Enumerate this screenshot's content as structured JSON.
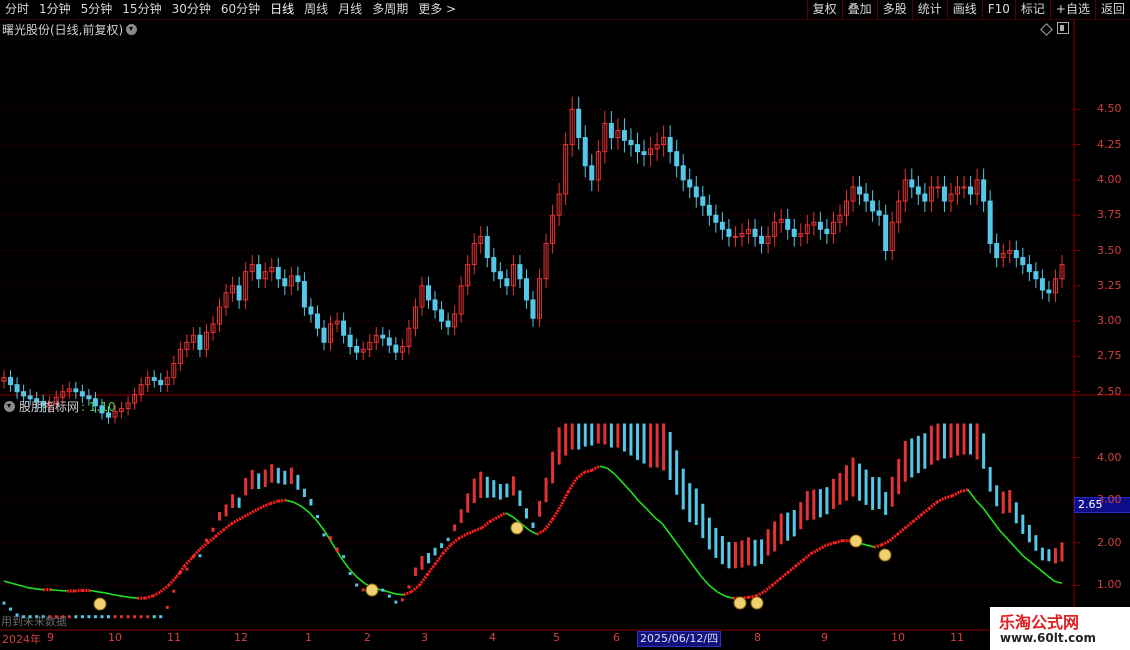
{
  "toolbar": {
    "periods": [
      "分时",
      "1分钟",
      "5分钟",
      "15分钟",
      "30分钟",
      "60分钟",
      "日线",
      "周线",
      "月线",
      "多周期",
      "更多 >"
    ],
    "active_period": "日线",
    "actions": [
      "复权",
      "叠加",
      "多股",
      "统计",
      "画线",
      "F10",
      "标记",
      "+自选",
      "返回"
    ]
  },
  "main_panel": {
    "title": "曙光股份(日线,前复权)",
    "yticks": [
      "4.50",
      "4.25",
      "4.00",
      "3.75",
      "3.50",
      "3.25",
      "3.00",
      "2.75",
      "2.50"
    ]
  },
  "indicator_panel": {
    "title": "股朋指标网",
    "value": ": 1.10",
    "yticks": [
      "4.00",
      "3.00",
      "2.00",
      "1.00"
    ],
    "price_tag": "2.65"
  },
  "xaxis": {
    "labels": [
      "2024年",
      "9",
      "10",
      "11",
      "12",
      "1",
      "2",
      "3",
      "4",
      "5",
      "6",
      "7",
      "8",
      "9",
      "10",
      "11"
    ],
    "cursor_date": "2025/06/12/四"
  },
  "future_note": "用到未来数据",
  "watermark": {
    "title": "乐淘公式网",
    "url": "www.60lt.com"
  },
  "colors": {
    "up": "#e63232",
    "down": "#54c8e8",
    "ma_up": "#ff2020",
    "ma_down": "#20e020",
    "axis": "#8b0000",
    "grid": "#5a0000"
  },
  "chart_data": [
    {
      "type": "candlestick",
      "title": "曙光股份(日线,前复权)",
      "ylim": [
        2.25,
        4.75
      ],
      "close": [
        2.6,
        2.55,
        2.5,
        2.47,
        2.45,
        2.43,
        2.4,
        2.42,
        2.46,
        2.5,
        2.52,
        2.5,
        2.47,
        2.45,
        2.4,
        2.35,
        2.32,
        2.36,
        2.38,
        2.42,
        2.48,
        2.55,
        2.6,
        2.58,
        2.55,
        2.6,
        2.7,
        2.8,
        2.85,
        2.9,
        2.8,
        2.92,
        2.98,
        3.1,
        3.2,
        3.25,
        3.15,
        3.35,
        3.4,
        3.3,
        3.35,
        3.38,
        3.3,
        3.25,
        3.32,
        3.28,
        3.1,
        3.05,
        2.95,
        2.85,
        2.98,
        3.0,
        2.9,
        2.82,
        2.78,
        2.8,
        2.85,
        2.9,
        2.88,
        2.83,
        2.78,
        2.82,
        2.95,
        3.1,
        3.25,
        3.15,
        3.08,
        3.0,
        2.96,
        3.05,
        3.25,
        3.4,
        3.55,
        3.6,
        3.45,
        3.35,
        3.3,
        3.25,
        3.4,
        3.3,
        3.15,
        3.02,
        3.3,
        3.55,
        3.75,
        3.9,
        4.25,
        4.5,
        4.3,
        4.1,
        4.0,
        4.2,
        4.4,
        4.3,
        4.35,
        4.28,
        4.25,
        4.2,
        4.18,
        4.22,
        4.25,
        4.3,
        4.2,
        4.1,
        4.0,
        3.95,
        3.88,
        3.82,
        3.75,
        3.7,
        3.65,
        3.6,
        3.6,
        3.62,
        3.65,
        3.6,
        3.55,
        3.6,
        3.7,
        3.72,
        3.65,
        3.6,
        3.62,
        3.68,
        3.7,
        3.65,
        3.62,
        3.7,
        3.75,
        3.85,
        3.95,
        3.9,
        3.85,
        3.78,
        3.75,
        3.5,
        3.7,
        3.85,
        4.0,
        3.95,
        3.9,
        3.85,
        3.95,
        3.95,
        3.85,
        3.9,
        3.95,
        3.95,
        3.9,
        4.0,
        3.85,
        3.55,
        3.45,
        3.48,
        3.5,
        3.45,
        3.4,
        3.35,
        3.3,
        3.22,
        3.2,
        3.3,
        3.4
      ],
      "series": [
        {
          "name": "K线"
        }
      ]
    },
    {
      "type": "bar",
      "title": "股朋指标网",
      "ylim": [
        0,
        5
      ],
      "series": [
        {
          "name": "MA",
          "values": [
            1.1,
            1.05,
            1.0,
            0.95,
            0.92,
            0.9,
            0.9,
            0.88,
            0.87,
            0.87,
            0.88,
            0.88,
            0.85,
            0.82,
            0.78,
            0.75,
            0.72,
            0.7,
            0.7,
            0.75,
            0.85,
            1.0,
            1.2,
            1.45,
            1.65,
            1.85,
            2.0,
            2.15,
            2.3,
            2.45,
            2.55,
            2.65,
            2.75,
            2.85,
            2.92,
            2.98,
            3.0,
            2.95,
            2.85,
            2.7,
            2.5,
            2.25,
            1.95,
            1.65,
            1.4,
            1.2,
            1.05,
            0.95,
            0.9,
            0.85,
            0.8,
            0.78,
            0.85,
            1.0,
            1.25,
            1.5,
            1.75,
            1.95,
            2.1,
            2.2,
            2.28,
            2.35,
            2.5,
            2.6,
            2.7,
            2.6,
            2.45,
            2.3,
            2.2,
            2.3,
            2.55,
            2.85,
            3.2,
            3.5,
            3.65,
            3.7,
            3.8,
            3.75,
            3.6,
            3.4,
            3.2,
            2.98,
            2.8,
            2.6,
            2.45,
            2.2,
            1.95,
            1.7,
            1.45,
            1.2,
            1.0,
            0.85,
            0.75,
            0.7,
            0.7,
            0.72,
            0.75,
            0.85,
            1.0,
            1.15,
            1.3,
            1.45,
            1.6,
            1.75,
            1.85,
            1.95,
            2.0,
            2.05,
            2.05,
            2.0,
            1.95,
            1.9,
            1.95,
            2.05,
            2.2,
            2.35,
            2.5,
            2.65,
            2.8,
            2.95,
            3.05,
            3.1,
            3.2,
            3.25,
            3.0,
            2.8,
            2.55,
            2.3,
            2.1,
            1.9,
            1.7,
            1.55,
            1.4,
            1.25,
            1.1,
            1.05
          ]
        }
      ]
    }
  ]
}
